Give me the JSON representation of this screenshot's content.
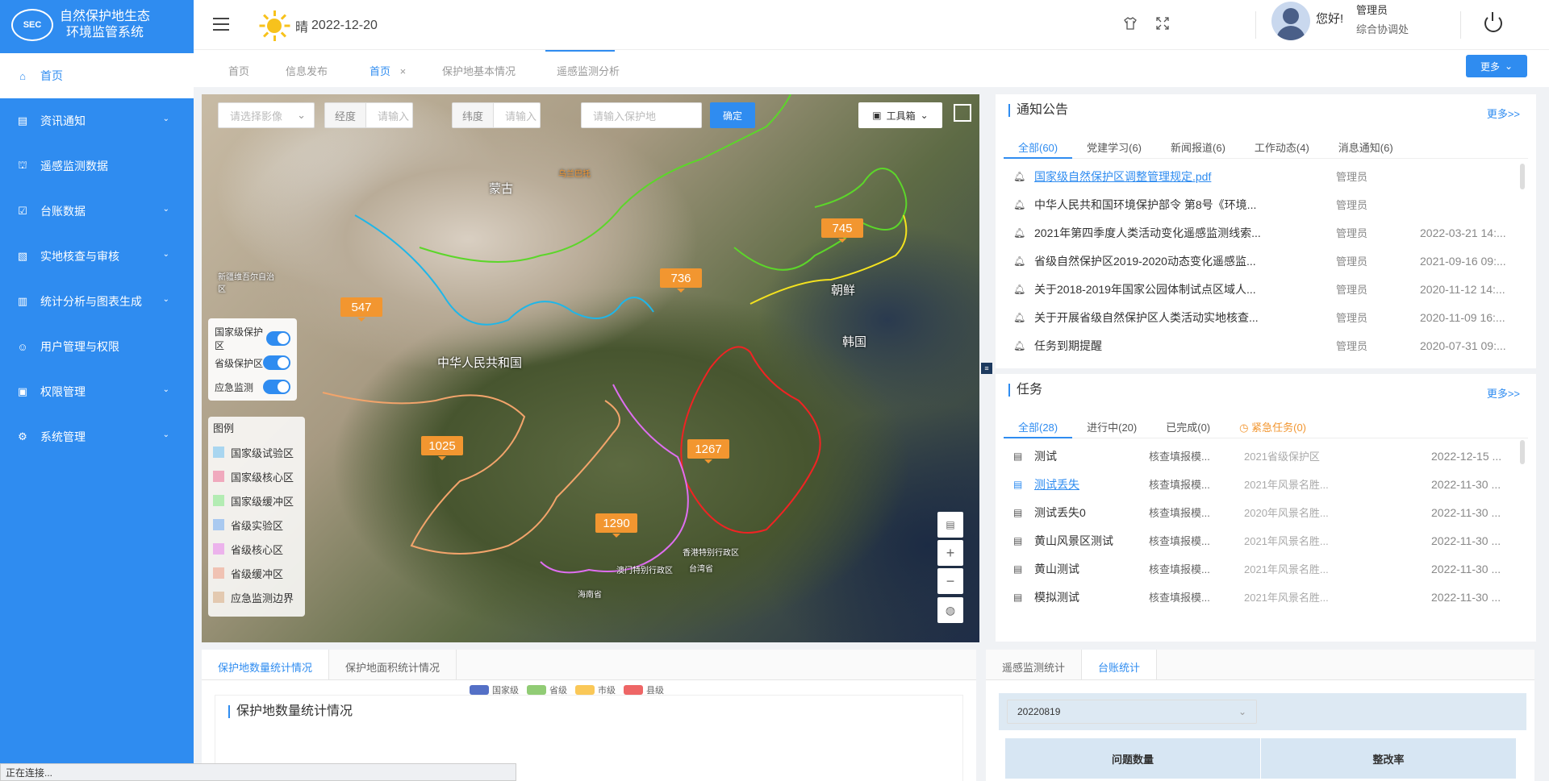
{
  "app": {
    "logo_text": "SEC",
    "title_line1": "自然保护地生态",
    "title_line2": "环境监管系统"
  },
  "sidebar": {
    "items": [
      {
        "label": "首页",
        "icon": "home-icon",
        "active": true
      },
      {
        "label": "资讯通知",
        "icon": "document-icon",
        "expandable": true
      },
      {
        "label": "遥感监测数据",
        "icon": "building-icon"
      },
      {
        "label": "台账数据",
        "icon": "checkbox-icon",
        "expandable": true
      },
      {
        "label": "实地核查与审核",
        "icon": "clipboard-icon",
        "expandable": true
      },
      {
        "label": "统计分析与图表生成",
        "icon": "bar-chart-icon",
        "expandable": true
      },
      {
        "label": "用户管理与权限",
        "icon": "user-icon"
      },
      {
        "label": "权限管理",
        "icon": "lock-icon",
        "expandable": true
      },
      {
        "label": "系统管理",
        "icon": "gear-icon",
        "expandable": true
      }
    ]
  },
  "header": {
    "weather": "晴",
    "date": "2022-12-20",
    "greeting": "您好!",
    "user_name": "管理员",
    "user_dept": "综合协调处"
  },
  "tabs": {
    "items": [
      "首页",
      "信息发布",
      "首页",
      "保护地基本情况",
      "遥感监测分析"
    ],
    "active_index": 2,
    "close": "×",
    "more_label": "更多"
  },
  "map": {
    "image_select_placeholder": "请选择影像",
    "lng_label": "经度",
    "lng_placeholder": "请输入",
    "lat_label": "纬度",
    "lat_placeholder": "请输入",
    "area_placeholder": "请输入保护地",
    "confirm_label": "确定",
    "toolbox_label": "工具箱",
    "labels": {
      "mongolia": "蒙古",
      "ulaanbaatar": "乌兰巴托",
      "china": "中华人民共和国",
      "korea_n": "朝鲜",
      "korea_s": "韩国",
      "xinjiang": "新疆维吾尔自治区",
      "hongkong": "香港特别行政区",
      "macau": "澳门特别行政区",
      "taiwan": "台湾省",
      "hainan": "海南省"
    },
    "markers": [
      "547",
      "736",
      "745",
      "1025",
      "1267",
      "1290"
    ],
    "toggles": [
      {
        "label": "国家级保护区",
        "on": true
      },
      {
        "label": "省级保护区",
        "on": true
      },
      {
        "label": "应急监测",
        "on": true
      }
    ],
    "legend_title": "图例",
    "legend": [
      {
        "label": "国家级试验区",
        "color": "#a9d6f0"
      },
      {
        "label": "国家级核心区",
        "color": "#f0a9bd"
      },
      {
        "label": "国家级缓冲区",
        "color": "#b3ecb3"
      },
      {
        "label": "省级实验区",
        "color": "#a9c9f0"
      },
      {
        "label": "省级核心区",
        "color": "#ecb3ec"
      },
      {
        "label": "省级缓冲区",
        "color": "#f0c2b3"
      },
      {
        "label": "应急监测边界",
        "color": "#e3c9b0"
      }
    ]
  },
  "notices": {
    "title": "通知公告",
    "more": "更多>>",
    "tabs": [
      "全部(60)",
      "党建学习(6)",
      "新闻报道(6)",
      "工作动态(4)",
      "消息通知(6)"
    ],
    "rows": [
      {
        "title": "国家级自然保护区调整管理规定.pdf",
        "author": "管理员",
        "date": "",
        "link": true
      },
      {
        "title": "中华人民共和国环境保护部令 第8号《环境...",
        "author": "管理员",
        "date": ""
      },
      {
        "title": "2021年第四季度人类活动变化遥感监测线索...",
        "author": "管理员",
        "date": "2022-03-21 14:..."
      },
      {
        "title": "省级自然保护区2019-2020动态变化遥感监...",
        "author": "管理员",
        "date": "2021-09-16 09:..."
      },
      {
        "title": "关于2018-2019年国家公园体制试点区域人...",
        "author": "管理员",
        "date": "2020-11-12 14:..."
      },
      {
        "title": "关于开展省级自然保护区人类活动实地核查...",
        "author": "管理员",
        "date": "2020-11-09 16:..."
      },
      {
        "title": "任务到期提醒",
        "author": "管理员",
        "date": "2020-07-31 09:..."
      }
    ]
  },
  "tasks": {
    "title": "任务",
    "more": "更多>>",
    "tabs": [
      "全部(28)",
      "进行中(20)",
      "已完成(0)",
      "紧急任务(0)"
    ],
    "rows": [
      {
        "name": "测试",
        "type": "核查填报模...",
        "area": "2021省级保护区",
        "date": "2022-12-15 ..."
      },
      {
        "name": "测试丢失",
        "type": "核查填报模...",
        "area": "2021年风景名胜...",
        "date": "2022-11-30 ...",
        "link": true
      },
      {
        "name": "测试丢失0",
        "type": "核查填报模...",
        "area": "2020年风景名胜...",
        "date": "2022-11-30 ..."
      },
      {
        "name": "黄山风景区测试",
        "type": "核查填报模...",
        "area": "2021年风景名胜...",
        "date": "2022-11-30 ..."
      },
      {
        "name": "黄山测试",
        "type": "核查填报模...",
        "area": "2021年风景名胜...",
        "date": "2022-11-30 ..."
      },
      {
        "name": "模拟测试",
        "type": "核查填报模...",
        "area": "2021年风景名胜...",
        "date": "2022-11-30 ..."
      }
    ]
  },
  "bottom_left": {
    "tabs": [
      "保护地数量统计情况",
      "保护地面积统计情况"
    ],
    "card_title": "保护地数量统计情况",
    "legend": [
      {
        "label": "国家级",
        "color": "#5470c6"
      },
      {
        "label": "省级",
        "color": "#91cc75"
      },
      {
        "label": "市级",
        "color": "#fac858"
      },
      {
        "label": "县级",
        "color": "#ee6666"
      }
    ]
  },
  "bottom_right": {
    "tabs": [
      "遥感监测统计",
      "台账统计"
    ],
    "select_value": "20220819",
    "columns": [
      "问题数量",
      "整改率"
    ]
  },
  "status": {
    "text": "正在连接..."
  }
}
